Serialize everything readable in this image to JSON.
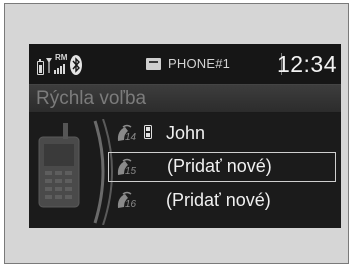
{
  "status_bar": {
    "roaming_indicator": "RM",
    "phone_name": "PHONE#1",
    "time": "12:34",
    "icons": [
      "battery-icon",
      "signal-strength-icon",
      "bluetooth-icon",
      "phone-icon"
    ]
  },
  "screen": {
    "title": "Rýchla voľba"
  },
  "speed_dial_list": {
    "selected_index": 1,
    "items": [
      {
        "slot": "14",
        "label": "John",
        "icon": "mobile-phone-icon"
      },
      {
        "slot": "15",
        "label": "(Pridať nové)"
      },
      {
        "slot": "16",
        "label": "(Pridať nové)"
      }
    ]
  },
  "colors": {
    "frame_background": "#d6d6d6",
    "screen_background": "#1b1b1b",
    "text_primary": "#f0f0f0",
    "text_dim": "#7c7c7c",
    "selection_border": "#cfcfcf"
  }
}
